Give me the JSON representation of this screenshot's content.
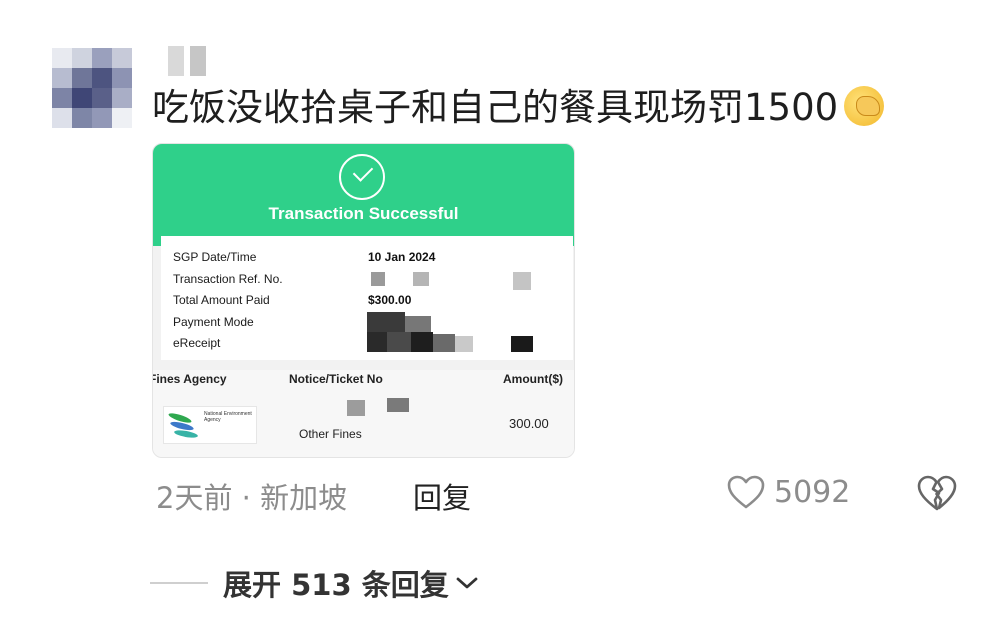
{
  "comment": {
    "text": "吃饭没收拾桌子和自己的餐具现场罚1500",
    "emoji": "facepalm-emoji",
    "meta": "2天前 · 新加坡",
    "reply_label": "回复",
    "likes": "5092",
    "expand_label": "展开 513 条回复"
  },
  "receipt": {
    "title": "Transaction Successful",
    "rows": [
      {
        "label": "SGP Date/Time",
        "value": "10 Jan 2024"
      },
      {
        "label": "Transaction Ref. No.",
        "value": ""
      },
      {
        "label": "Total Amount Paid",
        "value": "$300.00"
      },
      {
        "label": "Payment Mode",
        "value": ""
      },
      {
        "label": "eReceipt",
        "value": ""
      }
    ],
    "columns": [
      "Fines Agency",
      "Notice/Ticket No",
      "Amount($)"
    ],
    "agency_logo_text": "National Environment Agency",
    "fine_type": "Other Fines",
    "fine_amount": "300.00",
    "accent_color": "#2fd08a"
  },
  "icons": [
    "check-icon",
    "heart-icon",
    "broken-heart-icon",
    "chevron-down-icon"
  ]
}
